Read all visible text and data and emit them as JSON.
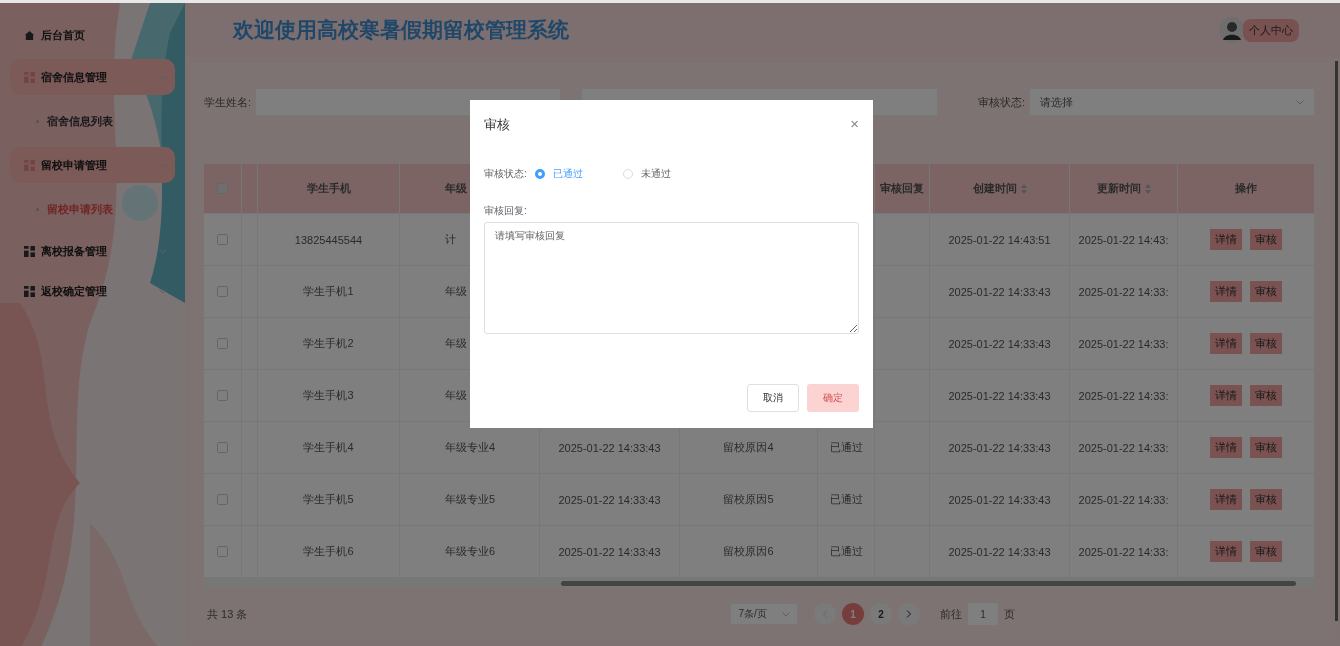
{
  "sidebar": {
    "items": [
      {
        "label": "后台首页",
        "kind": "link",
        "expanded": false
      },
      {
        "label": "宿舍信息管理",
        "kind": "group",
        "expanded": true,
        "children": [
          {
            "label": "宿舍信息列表",
            "selected": false
          }
        ]
      },
      {
        "label": "留校申请管理",
        "kind": "group",
        "expanded": true,
        "children": [
          {
            "label": "留校申请列表",
            "selected": true
          }
        ]
      },
      {
        "label": "离校报备管理",
        "kind": "group",
        "expanded": false
      },
      {
        "label": "返校确定管理",
        "kind": "group",
        "expanded": false
      }
    ]
  },
  "header": {
    "title": "欢迎使用高校寒暑假期留校管理系统",
    "user_button": "个人中心"
  },
  "filters": [
    {
      "label": "学生姓名:",
      "kind": "input"
    },
    {
      "kind": "input"
    },
    {
      "label": "审核状态:",
      "kind": "select",
      "placeholder": "请选择"
    }
  ],
  "table": {
    "select_all_checked": false,
    "columns": [
      {
        "label": "学生手机"
      },
      {
        "label": "年级"
      },
      null,
      null,
      null,
      {
        "label": "审核回复"
      },
      {
        "label": "创建时间",
        "sortable": true
      },
      {
        "label": "更新时间",
        "sortable": true
      },
      {
        "label": "操作"
      }
    ],
    "rows": [
      {
        "checked": false,
        "cells": [
          "13825445544",
          "计",
          null,
          null,
          null,
          null,
          "2025-01-22 14:43:51",
          "2025-01-22 14:43:"
        ],
        "actions": [
          "详情",
          "审核"
        ]
      },
      {
        "checked": false,
        "cells": [
          "学生手机1",
          "年级",
          null,
          null,
          null,
          null,
          "2025-01-22 14:33:43",
          "2025-01-22 14:33:"
        ],
        "actions": [
          "详情",
          "审核"
        ]
      },
      {
        "checked": false,
        "cells": [
          "学生手机2",
          "年级",
          null,
          null,
          null,
          null,
          "2025-01-22 14:33:43",
          "2025-01-22 14:33:"
        ],
        "actions": [
          "详情",
          "审核"
        ]
      },
      {
        "checked": false,
        "cells": [
          "学生手机3",
          "年级",
          null,
          null,
          null,
          null,
          "2025-01-22 14:33:43",
          "2025-01-22 14:33:"
        ],
        "actions": [
          "详情",
          "审核"
        ]
      },
      {
        "checked": false,
        "cells": [
          "学生手机4",
          "年级专业4",
          "2025-01-22 14:33:43",
          "留校原因4",
          "已通过",
          null,
          "2025-01-22 14:33:43",
          "2025-01-22 14:33:"
        ],
        "actions": [
          "详情",
          "审核"
        ]
      },
      {
        "checked": false,
        "cells": [
          "学生手机5",
          "年级专业5",
          "2025-01-22 14:33:43",
          "留校原因5",
          "已通过",
          null,
          "2025-01-22 14:33:43",
          "2025-01-22 14:33:"
        ],
        "actions": [
          "详情",
          "审核"
        ]
      },
      {
        "checked": false,
        "cells": [
          "学生手机6",
          "年级专业6",
          "2025-01-22 14:33:43",
          "留校原因6",
          "已通过",
          null,
          "2025-01-22 14:33:43",
          "2025-01-22 14:33:"
        ],
        "actions": [
          "详情",
          "审核"
        ]
      }
    ]
  },
  "pagination": {
    "total": "共 13 条",
    "page_size": "7条/页",
    "pages": [
      {
        "label": "1",
        "selected": true
      },
      {
        "label": "2",
        "selected": false
      }
    ],
    "goto_label": "前往",
    "goto_value": "1",
    "goto_suffix": "页"
  },
  "dialog": {
    "title": "审核",
    "close": "×",
    "status_label": "审核状态:",
    "options": [
      {
        "label": "已通过",
        "selected": true
      },
      {
        "label": "未通过",
        "selected": false
      }
    ],
    "reply_label": "审核回复:",
    "reply_placeholder": "请填写审核回复",
    "buttons": [
      {
        "label": "取消",
        "kind": "default"
      },
      {
        "label": "确定",
        "kind": "primary",
        "disabled": true
      }
    ]
  }
}
